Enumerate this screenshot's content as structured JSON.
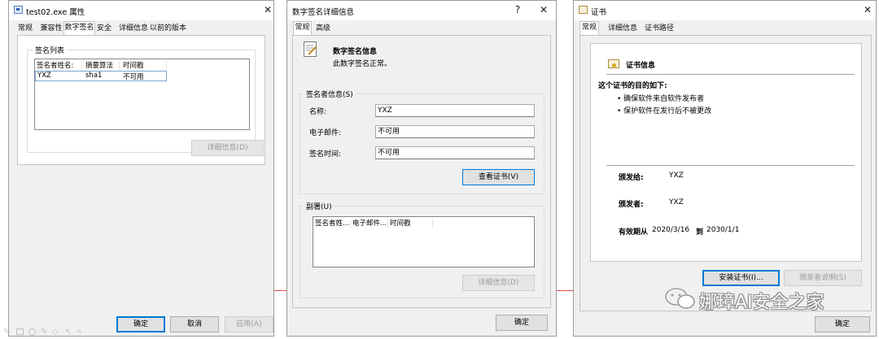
{
  "win1": {
    "title": "test02.exe 属性",
    "tabs": [
      "常规",
      "兼容性",
      "数字签名",
      "安全",
      "详细信息",
      "以前的版本"
    ],
    "group_label": "签名列表",
    "columns": [
      "签名者姓名:",
      "摘要算法",
      "时间戳"
    ],
    "rows": [
      [
        "YXZ",
        "sha1",
        "不可用"
      ]
    ],
    "details_btn": "详细信息(D)",
    "ok_btn": "确定",
    "cancel_btn": "取消",
    "apply_btn": "应用(A)"
  },
  "win2": {
    "title": "数字签名详细信息",
    "help": "?",
    "tabs": [
      "常规",
      "高级"
    ],
    "info_heading": "数字签名信息",
    "info_text": "此数字签名正常。",
    "signer_group": "签名者信息(S)",
    "name_label": "名称:",
    "name_value": "YXZ",
    "email_label": "电子邮件:",
    "email_value": "不可用",
    "time_label": "签名时间:",
    "time_value": "不可用",
    "view_cert_btn": "查看证书(V)",
    "countersig_group": "副署(U)",
    "cs_columns": [
      "签名者姓...",
      "电子邮件...",
      "时间戳"
    ],
    "cs_details_btn": "详细信息(D)",
    "ok_btn": "确定"
  },
  "win3": {
    "title": "证书",
    "tabs": [
      "常规",
      "详细信息",
      "证书路径"
    ],
    "cert_info_heading": "证书信息",
    "purpose_heading": "这个证书的目的如下:",
    "purposes": [
      "• 确保软件来自软件发布者",
      "• 保护软件在发行后不被更改"
    ],
    "issued_to_label": "颁发给:",
    "issued_to_value": "YXZ",
    "issued_by_label": "颁发者:",
    "issued_by_value": "YXZ",
    "validity_label": "有效期从",
    "valid_from": "2020/3/16",
    "to_label": "到",
    "valid_to": "2030/1/1",
    "install_btn": "安装证书(I)...",
    "issuer_stmt_btn": "颁发者说明(S)",
    "ok_btn": "确定"
  },
  "watermark": "娜璋AI安全之家",
  "colors": {
    "accent": "#0078d7",
    "bg": "#f0f0f0",
    "cert_red": "#c23b22"
  }
}
